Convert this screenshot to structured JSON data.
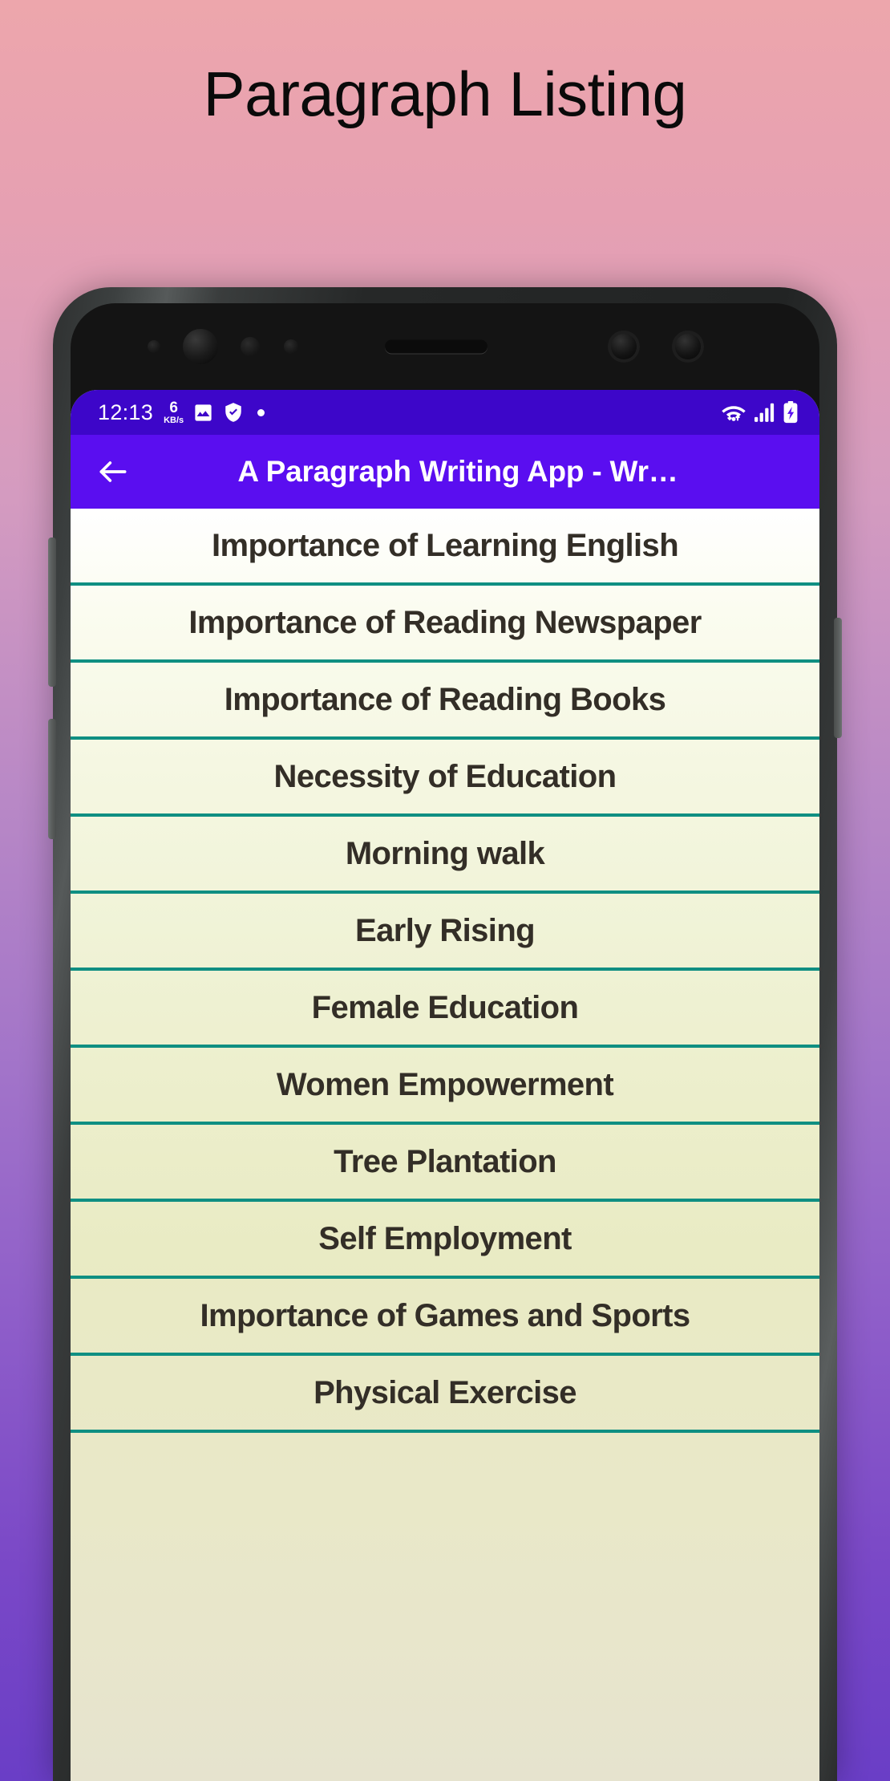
{
  "page": {
    "heading": "Paragraph Listing",
    "background_gradient_top": "#eda6ac",
    "background_gradient_bottom": "#6a3ec6"
  },
  "status_bar": {
    "time": "12:13",
    "net_speed_value": "6",
    "net_speed_unit": "KB/s",
    "icons_left": [
      "image-icon",
      "shield-check-icon",
      "dot-icon"
    ],
    "icons_right": [
      "wifi-icon",
      "cellular-signal-icon",
      "battery-charging-icon"
    ],
    "background_color": "#3d06c9",
    "text_color": "#ffffff"
  },
  "app_bar": {
    "back_icon": "arrow-left-icon",
    "title": "A Paragraph Writing App - Wr…",
    "background_color": "#5a0ef0",
    "text_color": "#ffffff"
  },
  "list": {
    "divider_color": "#0f8f82",
    "text_color": "#332e27",
    "items": [
      {
        "label": "Importance of Learning English"
      },
      {
        "label": "Importance of Reading Newspaper"
      },
      {
        "label": "Importance of Reading Books"
      },
      {
        "label": "Necessity of Education"
      },
      {
        "label": "Morning walk"
      },
      {
        "label": "Early Rising"
      },
      {
        "label": "Female Education"
      },
      {
        "label": "Women Empowerment"
      },
      {
        "label": "Tree Plantation"
      },
      {
        "label": "Self Employment"
      },
      {
        "label": "Importance of Games and Sports"
      },
      {
        "label": "Physical Exercise"
      }
    ]
  },
  "device": {
    "frame_color": "#2b2d2d",
    "buttons": [
      "volume-rocker",
      "power-button",
      "side-key"
    ]
  }
}
